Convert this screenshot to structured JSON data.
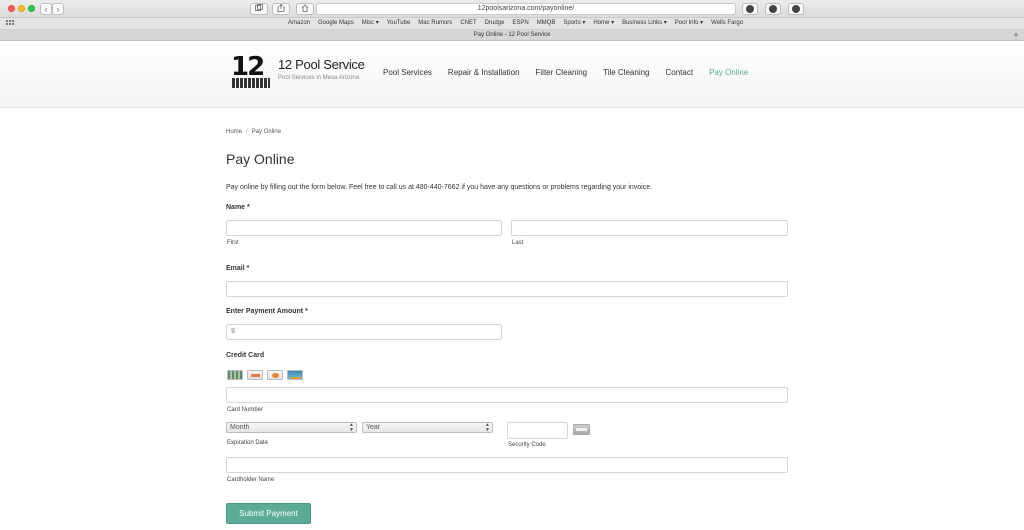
{
  "browser": {
    "url": "12poolsarizona.com/payonline/",
    "tab_title": "Pay Online - 12 Pool Service",
    "back_glyph": "‹",
    "forward_glyph": "›",
    "new_tab_glyph": "+",
    "bookmarks": [
      "Amazon",
      "Google Maps",
      "Misc ▾",
      "YouTube",
      "Mac Rumors",
      "CNET",
      "Drudge",
      "ESPN",
      "MMQB",
      "Sports ▾",
      "Home ▾",
      "Business Links ▾",
      "Pool Info ▾",
      "Wells Fargo"
    ]
  },
  "site": {
    "logo_text": "12",
    "title": "12 Pool Service",
    "tagline": "Pool Services in Mesa Arizona",
    "nav": [
      "Pool Services",
      "Repair & Installation",
      "Filter Cleaning",
      "Tile Cleaning",
      "Contact",
      "Pay Online"
    ],
    "active_nav": "Pay Online",
    "accent_color": "#5bab97"
  },
  "breadcrumb": {
    "home": "Home",
    "separator": "/",
    "current": "Pay Online"
  },
  "page": {
    "title": "Pay Online",
    "intro": "Pay online by filling out the form below. Feel free to call us at 480-440-7662 if you have any questions or problems regarding your invoice."
  },
  "form": {
    "name_label": "Name *",
    "first_label": "First",
    "last_label": "Last",
    "email_label": "Email *",
    "amount_label": "Enter Payment Amount *",
    "amount_placeholder": "$",
    "credit_card_label": "Credit Card",
    "card_icons": [
      "card-1-icon",
      "card-2-icon",
      "card-3-icon",
      "card-4-icon"
    ],
    "card_number_label": "Card Number",
    "month_value": "Month",
    "year_value": "Year",
    "expiration_label": "Expiration Date",
    "security_label": "Security Code",
    "cardholder_label": "Cardholder Name",
    "submit_label": "Submit Payment"
  }
}
